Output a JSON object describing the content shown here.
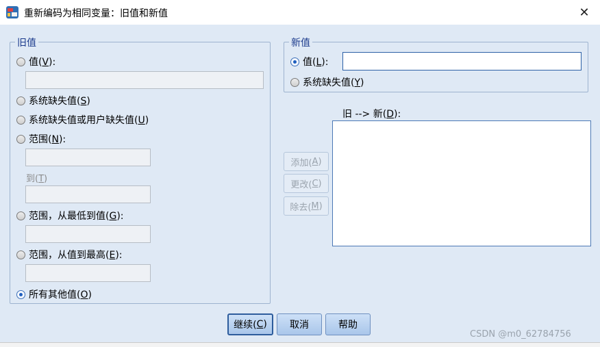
{
  "window": {
    "title": "重新编码为相同变量：旧值和新值",
    "close_glyph": "✕"
  },
  "old_value": {
    "legend": "旧值",
    "value_option": {
      "text": "值(",
      "key": "V",
      "tail": "):"
    },
    "sysmis_option": {
      "text": "系统缺失值(",
      "key": "S",
      "tail": ")"
    },
    "sysmis_or_user_option": {
      "text": "系统缺失值或用户缺失值(",
      "key": "U",
      "tail": ")"
    },
    "range_option": {
      "text": "范围(",
      "key": "N",
      "tail": "):"
    },
    "to_label": {
      "text": "到(",
      "key": "T",
      "tail": ")"
    },
    "range_lowest_option": {
      "text": "范围，从最低到值(",
      "key": "G",
      "tail": "):"
    },
    "range_highest_option": {
      "text": "范围，从值到最高(",
      "key": "E",
      "tail": "):"
    },
    "all_other_option": {
      "text": "所有其他值(",
      "key": "O",
      "tail": ")"
    },
    "selected": "all_other"
  },
  "new_value": {
    "legend": "新值",
    "value_option": {
      "text": "值(",
      "key": "L",
      "tail": "):"
    },
    "sysmis_option": {
      "text": "系统缺失值(",
      "key": "Y",
      "tail": ")"
    },
    "value_input": "",
    "selected": "value"
  },
  "mapping_list": {
    "label_text": "旧 --> 新(",
    "label_key": "D",
    "label_tail": "):",
    "items": []
  },
  "side_buttons": {
    "add": {
      "text": "添加(",
      "key": "A",
      "tail": ")"
    },
    "change": {
      "text": "更改(",
      "key": "C",
      "tail": ")"
    },
    "remove": {
      "text": "除去(",
      "key": "M",
      "tail": ")"
    }
  },
  "footer": {
    "continue": {
      "text": "继续(",
      "key": "C",
      "tail": ")"
    },
    "cancel": "取消",
    "help": "帮助"
  },
  "watermark": "CSDN @m0_62784756"
}
